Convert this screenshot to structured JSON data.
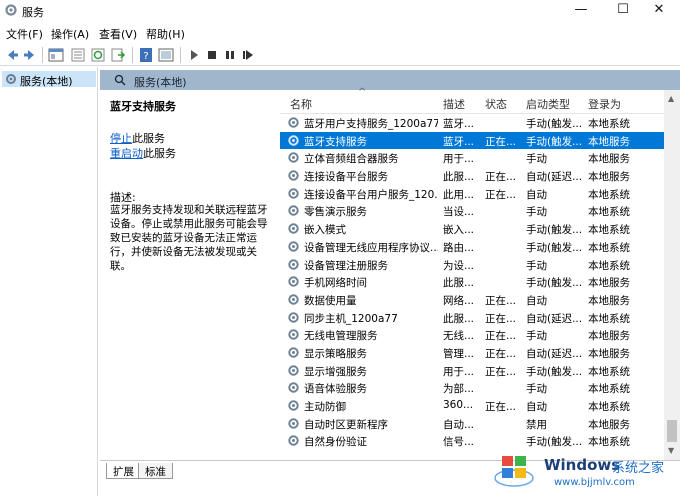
{
  "window": {
    "title": "服务",
    "minimize": "—",
    "maximize": "☐",
    "close": "✕"
  },
  "menu": [
    "文件(F)",
    "操作(A)",
    "查看(V)",
    "帮助(H)"
  ],
  "toolbar": [
    "back-icon",
    "forward-icon",
    "console-tree-icon",
    "properties-icon",
    "refresh-icon",
    "export-icon",
    "help-icon",
    "view-icon",
    "start-icon",
    "stop-icon",
    "pause-icon",
    "restart-icon"
  ],
  "tree": {
    "item": "服务(本地)"
  },
  "pane": {
    "header": "服务(本地)"
  },
  "detail": {
    "service_title": "蓝牙支持服务",
    "stop_link": "停止",
    "stop_suffix": "此服务",
    "restart_link": "重启动",
    "restart_suffix": "此服务",
    "desc_label": "描述:",
    "desc_text": "蓝牙服务支持发现和关联远程蓝牙设备。停止或禁用此服务可能会导致已安装的蓝牙设备无法正常运行，并使新设备无法被发现或关联。"
  },
  "columns": {
    "name": "名称",
    "desc": "描述",
    "status": "状态",
    "startup": "启动类型",
    "logon": "登录为"
  },
  "sort_indicator": "^",
  "services": [
    {
      "name": "蓝牙用户支持服务_1200a77",
      "desc": "蓝牙...",
      "status": "",
      "startup": "手动(触发...",
      "logon": "本地系统",
      "selected": false
    },
    {
      "name": "蓝牙支持服务",
      "desc": "蓝牙...",
      "status": "正在...",
      "startup": "手动(触发...",
      "logon": "本地服务",
      "selected": true
    },
    {
      "name": "立体音频组合器服务",
      "desc": "用于...",
      "status": "",
      "startup": "手动",
      "logon": "本地服务",
      "selected": false
    },
    {
      "name": "连接设备平台服务",
      "desc": "此服...",
      "status": "正在...",
      "startup": "自动(延迟...",
      "logon": "本地服务",
      "selected": false
    },
    {
      "name": "连接设备平台用户服务_120...",
      "desc": "此用...",
      "status": "正在...",
      "startup": "自动",
      "logon": "本地系统",
      "selected": false
    },
    {
      "name": "零售演示服务",
      "desc": "当设...",
      "status": "",
      "startup": "手动",
      "logon": "本地系统",
      "selected": false
    },
    {
      "name": "嵌入模式",
      "desc": "嵌入...",
      "status": "",
      "startup": "手动(触发...",
      "logon": "本地系统",
      "selected": false
    },
    {
      "name": "设备管理无线应用程序协议...",
      "desc": "路由...",
      "status": "",
      "startup": "手动(触发...",
      "logon": "本地系统",
      "selected": false
    },
    {
      "name": "设备管理注册服务",
      "desc": "为设...",
      "status": "",
      "startup": "手动",
      "logon": "本地系统",
      "selected": false
    },
    {
      "name": "手机网络时间",
      "desc": "此服...",
      "status": "",
      "startup": "手动(触发...",
      "logon": "本地服务",
      "selected": false
    },
    {
      "name": "数据使用量",
      "desc": "网络...",
      "status": "正在...",
      "startup": "自动",
      "logon": "本地服务",
      "selected": false
    },
    {
      "name": "同步主机_1200a77",
      "desc": "此服...",
      "status": "正在...",
      "startup": "自动(延迟...",
      "logon": "本地系统",
      "selected": false
    },
    {
      "name": "无线电管理服务",
      "desc": "无线...",
      "status": "正在...",
      "startup": "手动",
      "logon": "本地服务",
      "selected": false
    },
    {
      "name": "显示策略服务",
      "desc": "管理...",
      "status": "正在...",
      "startup": "自动(延迟...",
      "logon": "本地服务",
      "selected": false
    },
    {
      "name": "显示增强服务",
      "desc": "用于...",
      "status": "正在...",
      "startup": "手动(触发...",
      "logon": "本地系统",
      "selected": false
    },
    {
      "name": "语音体验服务",
      "desc": "为部...",
      "status": "",
      "startup": "手动",
      "logon": "本地系统",
      "selected": false
    },
    {
      "name": "主动防御",
      "desc": "360...",
      "status": "正在...",
      "startup": "自动",
      "logon": "本地系统",
      "selected": false
    },
    {
      "name": "自动时区更新程序",
      "desc": "自动...",
      "status": "",
      "startup": "禁用",
      "logon": "本地服务",
      "selected": false
    },
    {
      "name": "自然身份验证",
      "desc": "信号...",
      "status": "",
      "startup": "手动(触发...",
      "logon": "本地系统",
      "selected": false
    }
  ],
  "scroll": {
    "up": "▲",
    "down": "▼"
  },
  "tabs": [
    "扩展",
    "标准"
  ],
  "watermark": {
    "brand": "Windows",
    "site_cn": "系统之家",
    "url": "www.bjjmlv.com"
  },
  "colors": {
    "selection": "#0078d7",
    "pane_header": "#9fb6cd",
    "link": "#0b5ec9"
  }
}
